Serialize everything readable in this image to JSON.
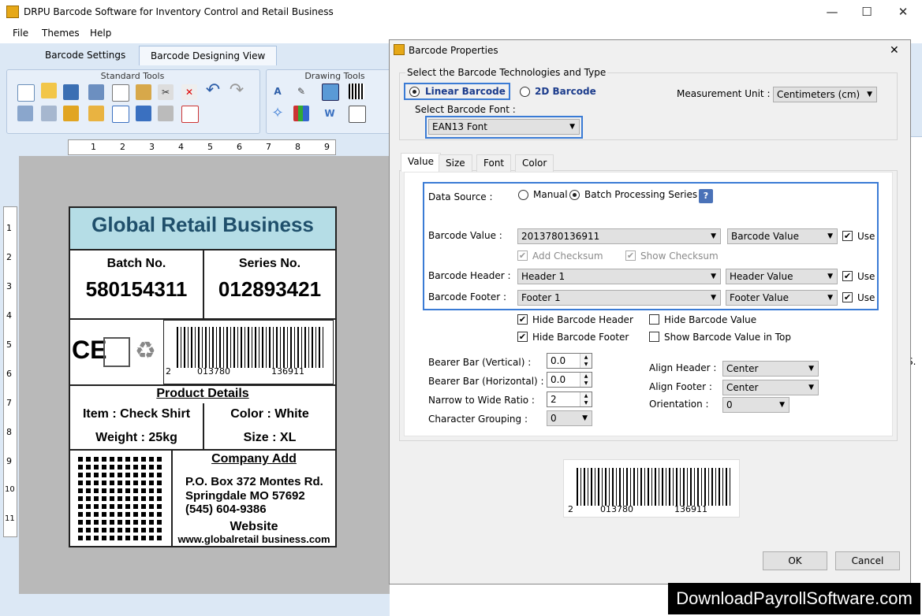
{
  "window": {
    "title": "DRPU Barcode Software for Inventory Control and Retail Business",
    "minimize": "—",
    "maximize": "☐",
    "close": "✕"
  },
  "menu": [
    "File",
    "Themes",
    "Help"
  ],
  "tabs": [
    "Barcode Settings",
    "Barcode Designing View"
  ],
  "ribbon": {
    "standard_tools": "Standard Tools",
    "drawing_tools": "Drawing Tools"
  },
  "ruler": {
    "h": [
      "1",
      "2",
      "3",
      "4",
      "5",
      "6",
      "7",
      "8",
      "9"
    ],
    "v": [
      "1",
      "2",
      "3",
      "4",
      "5",
      "6",
      "7",
      "8",
      "9",
      "10",
      "11"
    ]
  },
  "label": {
    "title": "Global Retail Business",
    "batch_label": "Batch No.",
    "batch_value": "580154311",
    "series_label": "Series No.",
    "series_value": "012893421",
    "ce_mark": "CE",
    "barcode_digits": [
      "2",
      "013780",
      "136911"
    ],
    "product_title": "Product Details",
    "item": "Item : Check Shirt",
    "color": "Color : White",
    "weight": "Weight : 25kg",
    "size": "Size : XL",
    "company_title": "Company Add",
    "address1": "P.O. Box 372 Montes Rd.",
    "address2": "Springdale MO 57692",
    "phone": "(545) 604-9386",
    "website_title": "Website",
    "website": "www.globalretail business.com"
  },
  "dialog": {
    "title": "Barcode Properties",
    "close": "✕",
    "tech_label": "Select the Barcode Technologies and Type",
    "linear": "Linear Barcode",
    "twod": "2D Barcode",
    "measure_label": "Measurement Unit :",
    "measure_value": "Centimeters (cm)",
    "font_label": "Select Barcode Font :",
    "font_value": "EAN13 Font",
    "tabs": [
      "Value",
      "Size",
      "Font",
      "Color"
    ],
    "data_source_label": "Data Source :",
    "manual": "Manual",
    "batch": "Batch Processing Series",
    "help": "?",
    "value_label": "Barcode Value :",
    "value_value": "2013780136911",
    "value_type": "Barcode Value",
    "use": "Use",
    "add_checksum": "Add Checksum",
    "show_checksum": "Show Checksum",
    "header_label": "Barcode Header :",
    "header_value": "Header 1",
    "header_type": "Header Value",
    "footer_label": "Barcode Footer :",
    "footer_value": "Footer 1",
    "footer_type": "Footer Value",
    "hide_header": "Hide Barcode Header",
    "hide_footer": "Hide Barcode Footer",
    "hide_value": "Hide Barcode Value",
    "show_value_top": "Show Barcode Value in Top",
    "bearer_v_label": "Bearer Bar (Vertical) :",
    "bearer_v": "0.0",
    "bearer_h_label": "Bearer Bar (Horizontal) :",
    "bearer_h": "0.0",
    "ratio_label": "Narrow to Wide Ratio :",
    "ratio": "2",
    "grouping_label": "Character Grouping :",
    "grouping": "0",
    "align_header_label": "Align Header :",
    "align_header": "Center",
    "align_footer_label": "Align Footer :",
    "align_footer": "Center",
    "orientation_label": "Orientation :",
    "orientation": "0",
    "preview_digits": [
      "2",
      "013780",
      "136911"
    ],
    "ok": "OK",
    "cancel": "Cancel"
  },
  "side_text": "S.",
  "watermark": "DownloadPayrollSoftware.com"
}
